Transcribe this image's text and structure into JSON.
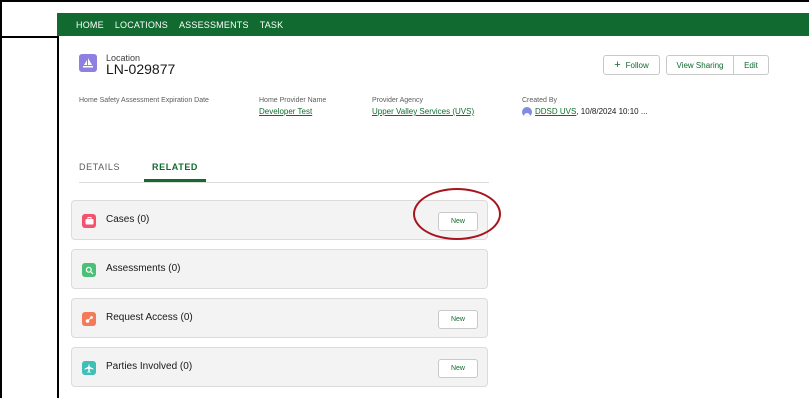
{
  "nav": {
    "items": [
      "HOME",
      "LOCATIONS",
      "ASSESSMENTS",
      "TASK"
    ]
  },
  "record": {
    "object_type": "Location",
    "name": "LN-029877",
    "icon": "sailboat-icon"
  },
  "actions": {
    "follow_label": "Follow",
    "view_sharing_label": "View Sharing",
    "edit_label": "Edit"
  },
  "fields": {
    "expiration_label": "Home Safety Assessment Expiration Date",
    "provider_name_label": "Home Provider Name",
    "provider_name_value": "Developer Test",
    "agency_label": "Provider Agency",
    "agency_value": "Upper Valley Services (UVS)",
    "created_label": "Created By",
    "created_user": "DDSD UVS",
    "created_date": ", 10/8/2024 10:10 ..."
  },
  "tabs": {
    "details": "DETAILS",
    "related": "RELATED",
    "active": "RELATED"
  },
  "related": {
    "new_label": "New",
    "cards": [
      {
        "title": "Cases (0)",
        "icon_color": "#f2536d"
      },
      {
        "title": "Assessments (0)",
        "icon_color": "#4bc076"
      },
      {
        "title": "Request Access (0)",
        "icon_color": "#f47a5a"
      },
      {
        "title": "Parties Involved (0)",
        "icon_color": "#3fbfb6"
      }
    ]
  },
  "colors": {
    "brand_green": "#116a2f",
    "annotation_red": "#a8141e"
  }
}
